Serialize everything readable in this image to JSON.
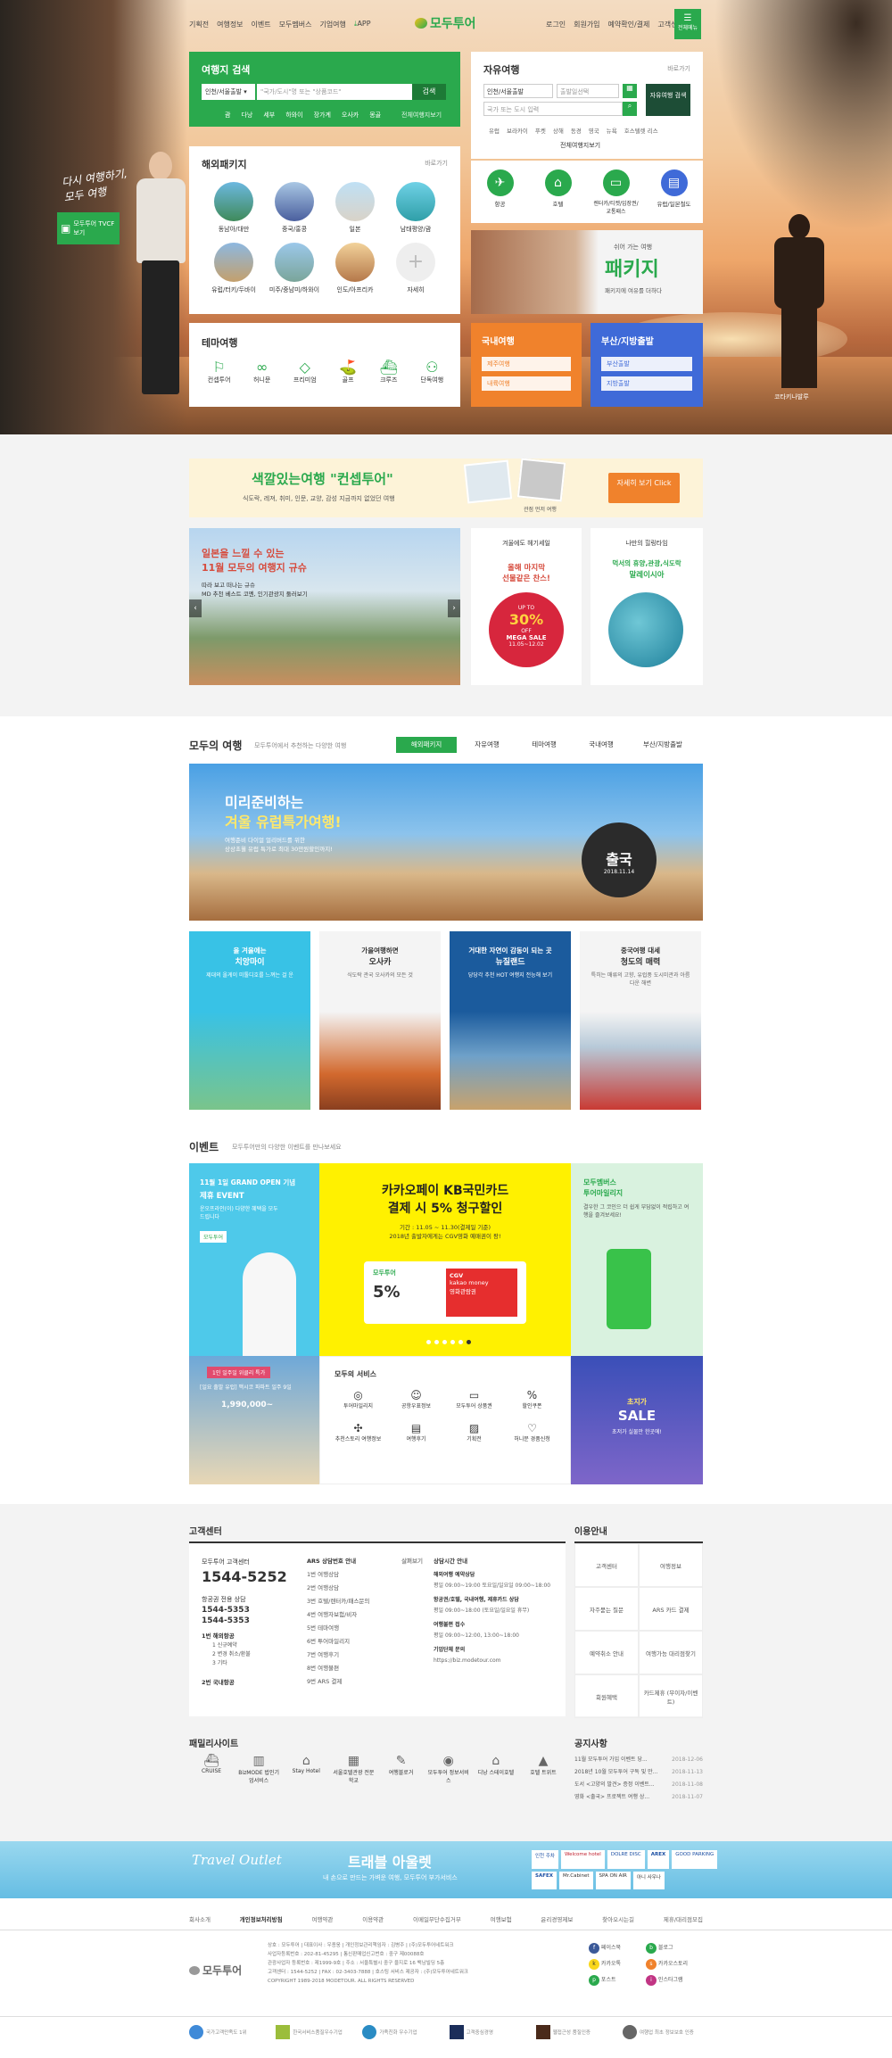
{
  "top_nav": {
    "left": [
      "기획전",
      "여행정보",
      "이벤트",
      "모두멤버스",
      "기업여행"
    ],
    "app": "APP",
    "logo": "모두투어",
    "right": [
      "로그인",
      "회원가입",
      "예약확인/결제",
      "고객센터"
    ],
    "all_menu": "전체메뉴"
  },
  "hero": {
    "promo_text": "다시 여행하기, 모두 여행",
    "tvcf": "모두투어 TVCF 보기",
    "location": "코타키나발루"
  },
  "search": {
    "title": "여행지 검색",
    "departure": "인천/서울출발",
    "placeholder": "\"국가/도시\"명 또는 \"상품코드\"",
    "button": "검색",
    "tags": [
      "괌",
      "다낭",
      "세부",
      "하와이",
      "장가계",
      "오사카",
      "몽골"
    ],
    "reserve": "전체여행지보기"
  },
  "free": {
    "title": "자유여행",
    "more": "바로가기",
    "departure": "인천/서울출발",
    "date": "출발일선택",
    "dest_placeholder": "국가 또는 도시 입력",
    "search_btn": "자유여행 검색",
    "tags": [
      "유럽",
      "보라카이",
      "푸켓",
      "상해",
      "동경",
      "영국",
      "뉴욕",
      "호스텔렛 리스"
    ],
    "all": "전체여행지보기"
  },
  "overseas": {
    "title": "해외패키지",
    "more": "바로가기",
    "items": [
      "동남아/대만",
      "중국/홍콩",
      "일본",
      "남태평양/괌",
      "유럽/터키/두바이",
      "미주/중남미/하와이",
      "인도/아프리카",
      "자세히"
    ]
  },
  "quick": {
    "items": [
      "항공",
      "호텔",
      "렌터카/티켓/입장권/교통패스",
      "유럽/일본철도"
    ]
  },
  "package_ad": {
    "line1": "쉬어 가는 여행",
    "title": "패키지",
    "line2": "패키지에 여유를 더하다"
  },
  "theme": {
    "title": "테마여행",
    "items": [
      "컨셉투어",
      "허니문",
      "프리미엄",
      "골프",
      "크루즈",
      "단독여행"
    ]
  },
  "domestic": {
    "title": "국내여행",
    "items": [
      "제주여행",
      "내륙여행"
    ]
  },
  "busan": {
    "title": "부산/지방출발",
    "items": [
      "부산출발",
      "지방출발"
    ]
  },
  "banner1": {
    "title": "색깔있는여행 \"컨셉투어\"",
    "sub": "식도락, 레져, 취미, 인문, 교양, 감성 지금까지 없었던 여행",
    "caption": "관점 먼저 여행",
    "cta": "자세히 보기 Click"
  },
  "promo": {
    "slide_t1": "일본을 느낄 수 있는",
    "slide_t2": "11월 모두의 여행지 규슈",
    "slide_sub1": "따라 보고 떠나는 규슈",
    "slide_sub2": "MD 추천 베스트 코멘, 인기관광지 둘러보기",
    "mid_top": "겨울에도 헤기세일",
    "mid_t1": "올해 마지막",
    "mid_t2": "선물같은 찬스!",
    "mega_up": "UP TO",
    "mega_pct": "30%",
    "mega_off": "OFF",
    "mega_sale": "MEGA SALE",
    "mega_date": "11.05~12.02",
    "right_top": "나만의 힐링타임",
    "right_t1": "먹서의 휴양,관광,식도락",
    "right_t2": "말레이시아"
  },
  "modu": {
    "title": "모두의 여행",
    "sub": "모두투어에서 추천하는 다양한 여행",
    "tabs": [
      "해외패키지",
      "자유여행",
      "테마여행",
      "국내여행",
      "부산/지방출발"
    ],
    "big_t1": "미리준비하는",
    "big_t2": "겨울 유럽특가여행!",
    "big_sub1": "여행준비 다이얼 얼리버드를 위한",
    "big_sub2": "상상초월 유럽 특가로 최대 30만원할인까지!",
    "big_badge": "출국",
    "big_date": "2018.11.14"
  },
  "cards": [
    {
      "t1": "올 겨울에는",
      "t2": "치앙마이",
      "s": "제대의 올게이 미톨디호를 느껴는 걸 운"
    },
    {
      "t1": "가을여행하면",
      "t2": "오사카",
      "s": "식도락 관국 오사카의 모든 것"
    },
    {
      "t1": "거대한 자연이 감동이 되는 곳",
      "t2": "뉴질랜드",
      "s": "당당각 추천 HOT 여행지 전능해 보기"
    },
    {
      "t1": "중국여행 대세",
      "t2": "청도의 매력",
      "s": "특히는 매류의 고향, 유럽풍 도시미관과 아름다운 해변"
    }
  ],
  "event": {
    "title": "이벤트",
    "sub": "모두투어만의 다양한 이벤트를 만나보세요",
    "e1_t1": "11월 1일 GRAND OPEN 기념",
    "e1_t2": "제휴 EVENT",
    "e1_s": "운오프라인(이) 다양한 혜택을 모두 드립니다",
    "e1_b": "모두투어",
    "kb_t1": "카카오페이 KB국민카드",
    "kb_t2": "결제 시 5% 청구할인",
    "kb_s1": "기간 : 11.05 ~ 11.30(결제일 기준)",
    "kb_s2": "2018년 출발자에게는 CGV영화 예매권이 팡!",
    "kb_logo": "모두투어",
    "kb_pct": "5%",
    "kb_money": "kakao money",
    "kb_cgv": "CGV",
    "kb_mv": "영화관람권",
    "lug_t1": "모두멤버스",
    "lug_t2": "투어마일리지",
    "lug_s": "결우한 그 코인으 더 쉽게 부담없이 적립하고 여행을 즐겨보세요!",
    "fest_tag": "1인 일주일 위클리 특가",
    "fest_t": "[일요 출발 유럽] 맥시코 파파트 일주 9일",
    "fest_price": "1,990,000~",
    "svc_title": "모두의 서비스",
    "svc": [
      "투어마일리지",
      "공항우표정보",
      "모두투어 상품권",
      "할인쿠폰",
      "추천스토리 여행정보",
      "여행후기",
      "기획전",
      "허니문 경품신청"
    ],
    "sale_t1": "초지가",
    "sale_t2": "SALE",
    "sale_s": "초저가 실물만 한곳에!"
  },
  "support": {
    "title": "고객센터",
    "center": "모두투어 고객센터",
    "phone": "1544-5252",
    "air": "항공권 전용 상담",
    "air_p1": "1544-5353",
    "air_p2": "1544-5353",
    "menu_title": "1번 해외항공",
    "menu": [
      "1 신규예약",
      "2 변경 취소/환불",
      "3 기타"
    ],
    "menu2": "2번 국내항공",
    "ars_title": "ARS 상담번호 안내",
    "ars_more": "살펴보기",
    "ars": [
      "1번 여행상담",
      "2번 여행상담",
      "3번 호텔/렌터카/패스문의",
      "4번 여행자보험/비자",
      "5번 테마여행",
      "6번 투어마일리지",
      "7번 여행후기",
      "8번 여행불편",
      "9번 ARS 결제"
    ],
    "hours_title": "상담시간 안내",
    "hours": [
      "해외여행 예약상담",
      "평일 09:00~19:00 토요일/일요일 09:00~18:00",
      "항공권/호텔, 국내여행, 제휴카드 상담",
      "평일 09:00~18:00 (토요일/일요일 휴무)",
      "여행불편 접수",
      "평일 09:00~12:00, 13:00~18:00",
      "기업단체 문의",
      "https://biz.modetour.com"
    ]
  },
  "guide": {
    "title": "이용안내",
    "items": [
      "고객센터",
      "여행정보",
      "자주묻는 질문",
      "ARS 카드 결제",
      "예약취소 안내",
      "여행가능 대리점찾기",
      "회원혜택",
      "카드제휴 (무이자/이벤트)"
    ]
  },
  "family": {
    "title": "패밀리사이트",
    "items": [
      "CRUISE",
      "BizMODE 법인기업서비스",
      "Stay Hotel",
      "서울호텔관광 전문학교",
      "여행블로거",
      "모두투어 정보서비스",
      "디낭 스테이호텔",
      "호텔 트위트"
    ]
  },
  "notice": {
    "title": "공지사항",
    "items": [
      {
        "t": "11월 모두투어 가입 이벤트 당...",
        "d": "2018-12-06"
      },
      {
        "t": "2018년 10월 모두투어 구독 및 만...",
        "d": "2018-11-13"
      },
      {
        "t": "도서 <고양의 발견> 증정 이벤트...",
        "d": "2018-11-08"
      },
      {
        "t": "영화 <출국> 프로젝트 여행 상...",
        "d": "2018-11-07"
      }
    ]
  },
  "outlet": {
    "title": "트래블 아울렛",
    "sub": "내 손으로 만드는 가벼운 여행, 모두투어 부가서비스",
    "script": "Travel Outlet",
    "logos": [
      "인천 주차",
      "Welcome hotel",
      "DOLRE DISC",
      "AREX",
      "GOOD PARKING",
      "SAFEX",
      "Mr.Cabinet",
      "SPA ON AIR",
      "아니 사우나"
    ]
  },
  "footer": {
    "links": [
      "회사소개",
      "개인정보처리방침",
      "여행약관",
      "이용약관",
      "이메일무단수집거부",
      "여행보험",
      "윤리경영제보",
      "찾아오시는길",
      "제휴/대리점모집"
    ],
    "logo": "모두투어",
    "company": [
      "상호 : 모두투어 | 대표이사 : 우종웅 | 개인정보관리책임자 : 김병주 | (주)모두투어네트워크",
      "사업자등록번호 : 202-81-45295 | 통신판매업신고번호 : 중구 제00088호",
      "관광사업자 등록번호 : 제1999-9호 | 주소 : 서울특별시 중구 을지로 16 백남빌딩 5층",
      "고객센터 : 1544-5252 | FAX : 02-3403-7888 | 호스팅 서비스 제공자 : (주)모두투어네트워크",
      "COPYRIGHT 1989-2018 MODETOUR. ALL RIGHTS RESERVED"
    ],
    "sns": [
      "페이스북",
      "블로그",
      "카카오톡",
      "카카오스토리",
      "포스트",
      "인스타그램"
    ],
    "certs": [
      "국가고객만족도 1위",
      "한국서비스품질우수기업",
      "가족친화 우수기업",
      "고객중심경영",
      "웹접근성 품질인증",
      "여행업 최초 정보보호 인증"
    ]
  },
  "colors": {
    "brand": "#2aa94d",
    "orange": "#f0822c",
    "blue": "#3f6ad8",
    "teal": "#1ba2c9"
  }
}
